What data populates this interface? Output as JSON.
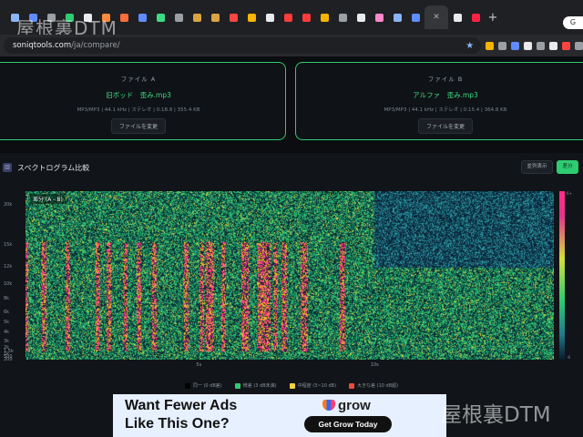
{
  "browser": {
    "url_host": "soniqtools.com",
    "url_path": "/ja/compare/",
    "tab_count": 26,
    "tab_colors": [
      "#8ab4f8",
      "#5f8cff",
      "#9aa0a6",
      "#2ecc71",
      "#e8eaed",
      "#ff8a3d",
      "#ff6d3a",
      "#5f8cff",
      "#3ddc84",
      "#9aa0a6",
      "#d9a441",
      "#d9a441",
      "#ff4444",
      "#f4b400",
      "#e8eaed",
      "#ff3b3b",
      "#ff3b3b",
      "#f4b400",
      "#9aa0a6",
      "#e8eaed",
      "#ff88cc",
      "#8ab4f8",
      "#5f8cff",
      "#e8eaed",
      "#e8eaed",
      "#ff2244"
    ],
    "profile_label": "G"
  },
  "watermark": {
    "top": "屋根裏DTM",
    "bottom": "屋根裏DTM"
  },
  "file_a": {
    "title": "ファイル A",
    "name": "旧ボッド　歪み.mp3",
    "meta": "MP3/MP3 | 44.1 kHz | ステレオ | 0:18.8 | 355.4 KB",
    "button": "ファイルを変更"
  },
  "file_b": {
    "title": "ファイル B",
    "name": "アルファ　歪み.mp3",
    "meta": "MP3/MP3 | 44.1 kHz | ステレオ | 0:15.4 | 364.8 KB",
    "button": "ファイルを変更"
  },
  "spectrogram": {
    "title": "スペクトログラム比較",
    "btn_side": "並列表示",
    "btn_diff": "差分",
    "overlay_label": "差分 (A - B)",
    "y_ticks": [
      "20k",
      "15k",
      "12k",
      "10k",
      "8k",
      "6k",
      "5k",
      "4k",
      "3k",
      "2k",
      "1.5k",
      "1k",
      "500",
      "200"
    ],
    "x_ticks": [
      "5s",
      "10s"
    ],
    "colorbar_ticks": [
      "6+",
      "",
      "",
      "",
      "",
      "",
      "-6"
    ],
    "colors": {
      "background": "#0e3b2e",
      "hot": "#ff2d8a",
      "warm": "#d4e03a",
      "mid": "#2ecc71",
      "cool": "#1f7a8c"
    }
  },
  "legend": [
    {
      "label": "同一 (0 dB差)",
      "color": "#000000"
    },
    {
      "label": "微差 (3 dB未満)",
      "color": "#2ecc71"
    },
    {
      "label": "中程度 (3~10 dB)",
      "color": "#f4d03f"
    },
    {
      "label": "大きな差 (10 dB超)",
      "color": "#e74c3c"
    }
  ],
  "ad": {
    "line1": "Want Fewer Ads",
    "line2": "Like This One?",
    "brand": "grow",
    "cta": "Get Grow Today"
  }
}
